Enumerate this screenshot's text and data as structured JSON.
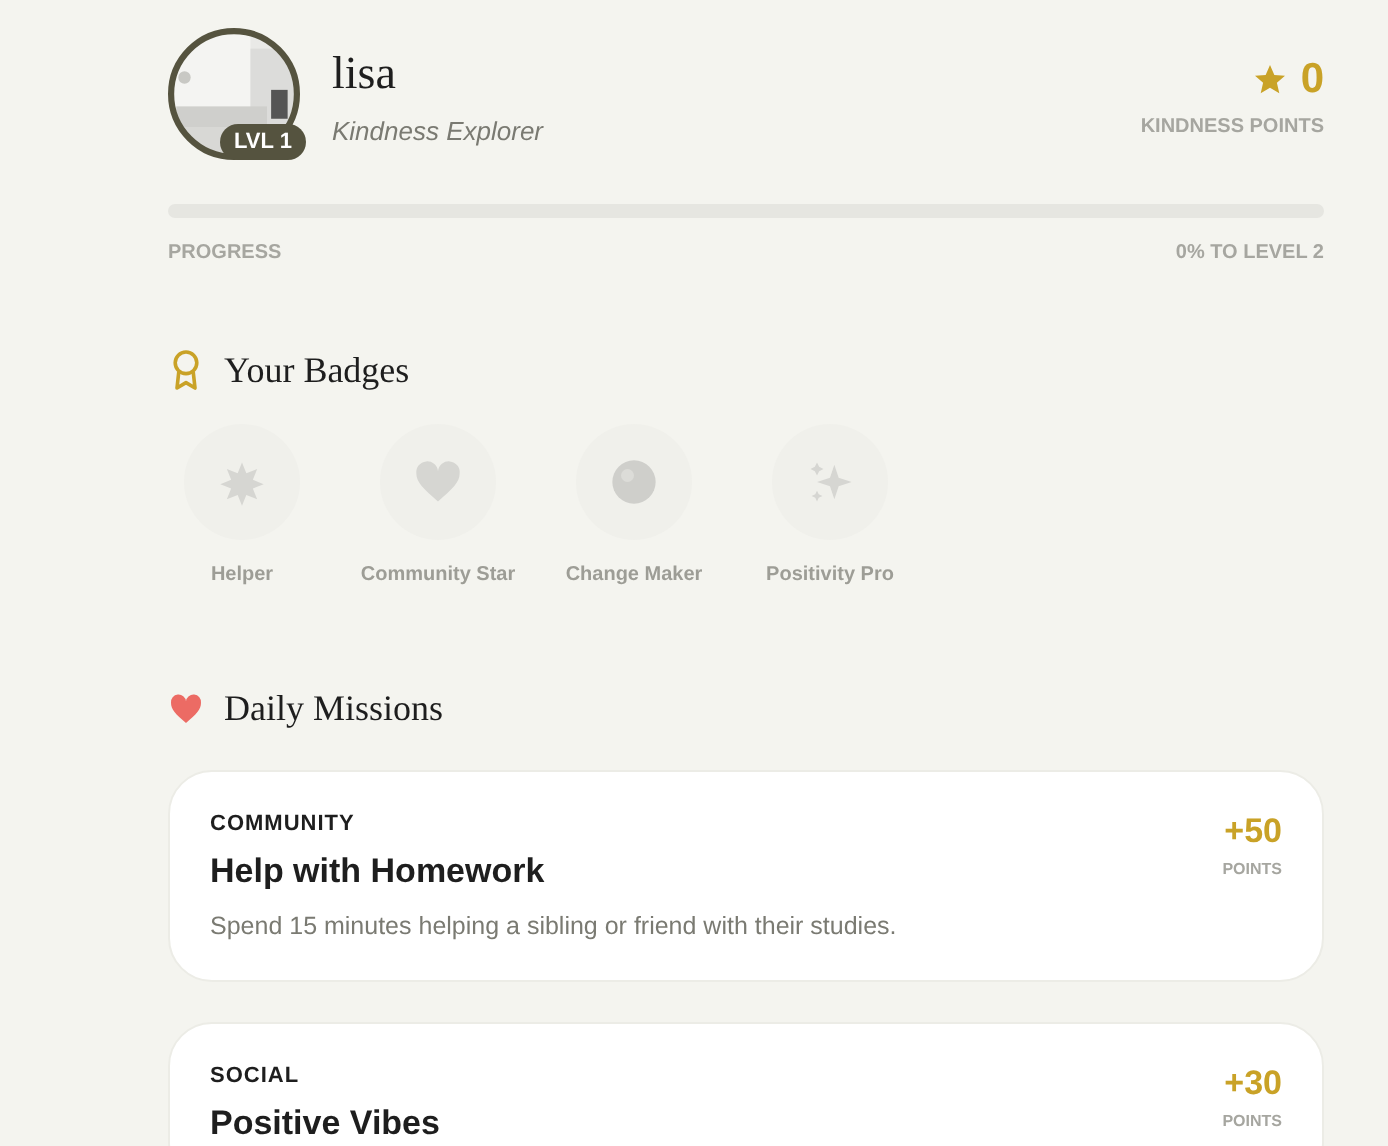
{
  "profile": {
    "name": "lisa",
    "title": "Kindness Explorer",
    "level_badge": "LVL 1",
    "points": "0",
    "points_label": "KINDNESS POINTS"
  },
  "progress": {
    "label": "PROGRESS",
    "level": 0,
    "reading": "0% TO LEVEL 2"
  },
  "badges": {
    "title": "Your Badges",
    "items": [
      {
        "name": "Helper",
        "kind": "burst",
        "earned": false
      },
      {
        "name": "Community Star",
        "kind": "heart",
        "earned": false
      },
      {
        "name": "Change Maker",
        "kind": "globe",
        "earned": false
      },
      {
        "name": "Positivity Pro",
        "kind": "sparkle",
        "earned": false
      }
    ]
  },
  "missions": {
    "title": "Daily Missions",
    "items": [
      {
        "category": "COMMUNITY",
        "title": "Help with Homework",
        "description": "Spend 15 minutes helping a sibling or friend with their studies.",
        "points": "+50",
        "points_label": "POINTS"
      },
      {
        "category": "SOCIAL",
        "title": "Positive Vibes",
        "points": "+30",
        "points_label": "POINTS"
      }
    ]
  }
}
